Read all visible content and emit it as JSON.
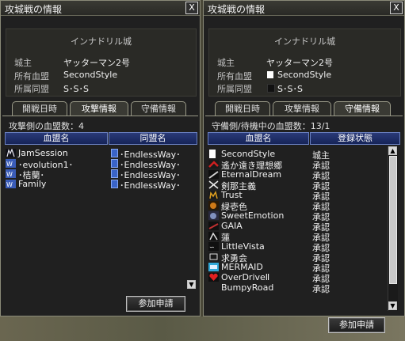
{
  "left": {
    "title": "攻城戦の情報",
    "close": "X",
    "castle": "インナドリル城",
    "lord_label": "城主",
    "lord_value": "ヤッターマン2号",
    "pledge_label": "所有血盟",
    "pledge_value": "SecondStyle",
    "alliance_label": "所属同盟",
    "alliance_value": "S･S･S",
    "tabs": [
      "開戦日時",
      "攻撃情報",
      "守備情報"
    ],
    "active_tab": "攻撃情報",
    "count_text": "攻撃側の血盟数：4",
    "headers": [
      "血盟名",
      "同盟名"
    ],
    "rows": [
      {
        "name": "JamSession",
        "alliance": "･EndlessWay･"
      },
      {
        "name": "･evolution1･",
        "alliance": "･EndlessWay･"
      },
      {
        "name": "･桔蘭･",
        "alliance": "･EndlessWay･"
      },
      {
        "name": "Family",
        "alliance": "･EndlessWay･"
      }
    ],
    "button": "参加申請"
  },
  "right": {
    "title": "攻城戦の情報",
    "close": "X",
    "castle": "インナドリル城",
    "lord_label": "城主",
    "lord_value": "ヤッターマン2号",
    "pledge_label": "所有血盟",
    "pledge_value": "SecondStyle",
    "alliance_label": "所属同盟",
    "alliance_value": "S･S･S",
    "tabs": [
      "開戦日時",
      "攻撃情報",
      "守備情報"
    ],
    "active_tab": "守備情報",
    "count_text": "守備側/待機中の血盟数：13/1",
    "headers": [
      "血盟名",
      "登録状態"
    ],
    "rows": [
      {
        "name": "SecondStyle",
        "status": "城主"
      },
      {
        "name": "遙か遠き理想郷",
        "status": "承認"
      },
      {
        "name": "EternalDream",
        "status": "承認"
      },
      {
        "name": "剣那主義",
        "status": "承認"
      },
      {
        "name": "Trust",
        "status": "承認"
      },
      {
        "name": "緑壱色",
        "status": "承認"
      },
      {
        "name": "SweetEmotion",
        "status": "承認"
      },
      {
        "name": "GAIA",
        "status": "承認"
      },
      {
        "name": "蓮",
        "status": "承認"
      },
      {
        "name": "LittleVista",
        "status": "承認"
      },
      {
        "name": "求勇会",
        "status": "承認"
      },
      {
        "name": "MERMAID",
        "status": "承認"
      },
      {
        "name": "OverDriveⅡ",
        "status": "承認"
      },
      {
        "name": "BumpyRoad",
        "status": "承認"
      }
    ],
    "button": "参加申請"
  },
  "colors": {
    "header_blue": "#1e2c68",
    "window_bg": "#202020",
    "border": "#8a8a78"
  },
  "icons": [
    "clan-emblem-icon",
    "alliance-icon",
    "scroll-up-arrow-icon",
    "scroll-down-arrow-icon",
    "close-icon"
  ]
}
